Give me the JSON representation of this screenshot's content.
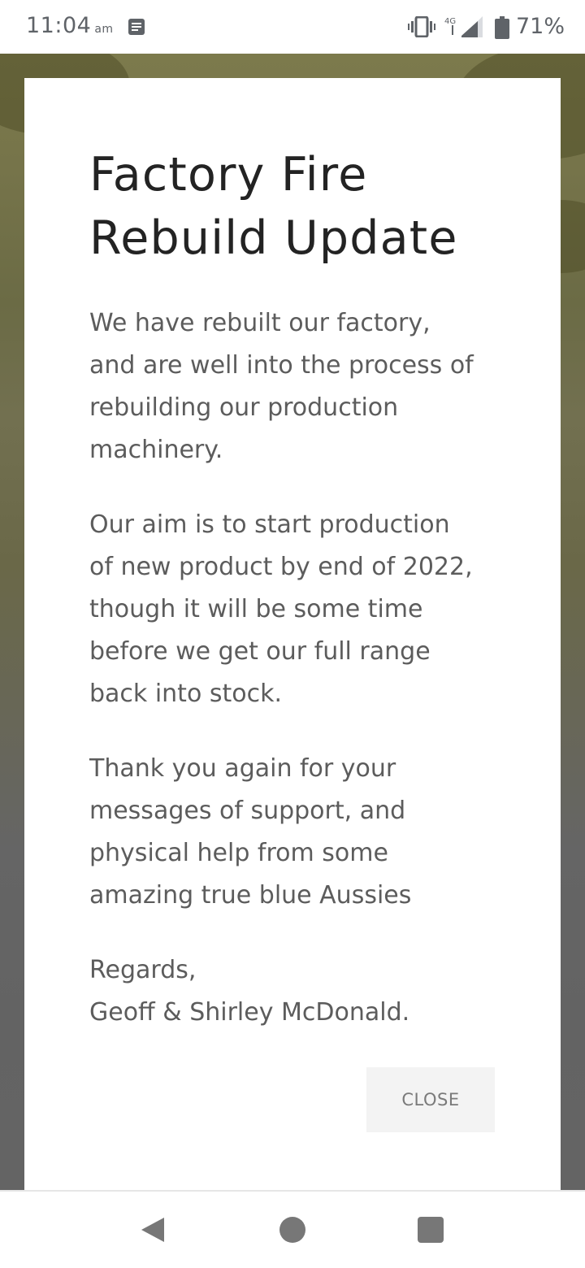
{
  "status_bar": {
    "time": "11:04",
    "ampm": "am",
    "network": "4G",
    "battery_percent": "71%",
    "icons": [
      "notification-icon",
      "vibrate-icon",
      "signal-icon",
      "battery-icon"
    ]
  },
  "dialog": {
    "title_line1": "Factory Fire",
    "title_line2": "Rebuild Update",
    "paragraphs": [
      [
        "We have rebuilt our factory,",
        "and are well into the process of",
        "rebuilding our production",
        "machinery."
      ],
      [
        "Our aim is to start production",
        "of new product by end of 2022,",
        "though it will be some time",
        "before we get our full range",
        "back into stock."
      ],
      [
        "Thank you again for your",
        "messages of support, and",
        "physical help from some",
        "amazing true blue Aussies"
      ],
      [
        "Regards,",
        "Geoff & Shirley McDonald."
      ]
    ],
    "close_label": "CLOSE"
  },
  "nav_bar": {
    "icons": [
      "back-icon",
      "home-icon",
      "recents-icon"
    ]
  },
  "colors": {
    "title": "#232323",
    "body_text": "#5c5c5c",
    "close_bg": "#f3f3f3",
    "close_text": "#7a7a7a",
    "backdrop": "#6b6b45"
  }
}
